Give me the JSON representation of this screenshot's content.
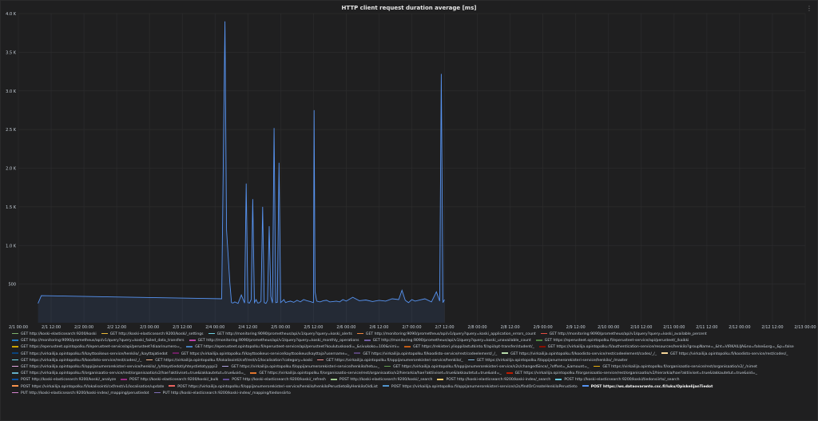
{
  "chart_data": {
    "type": "line",
    "title": "HTTP client request duration average [ms]",
    "ylim": [
      0,
      4000
    ],
    "y_ticks": [
      "4.0 K",
      "3.5 K",
      "3.0 K",
      "2.5 K",
      "2.0 K",
      "1.5 K",
      "1.0 K",
      "500"
    ],
    "y_tick_values": [
      4000,
      3500,
      3000,
      2500,
      2000,
      1500,
      1000,
      500
    ],
    "x_ticks": [
      "2/1 00:00",
      "2/1 12:00",
      "2/2 00:00",
      "2/2 12:00",
      "2/3 00:00",
      "2/3 12:00",
      "2/4 00:00",
      "2/4 12:00",
      "2/5 00:00",
      "2/5 12:00",
      "2/6 00:00",
      "2/6 12:00",
      "2/7 00:00",
      "2/7 12:00",
      "2/8 00:00",
      "2/8 12:00",
      "2/9 00:00",
      "2/9 12:00",
      "2/10 00:00",
      "2/10 12:00",
      "2/11 00:00",
      "2/11 12:00",
      "2/12 00:00",
      "2/12 12:00",
      "2/13 00:00"
    ],
    "grid": true,
    "series": [
      {
        "name": "POST https://ws.dataovaranto.csc.fi/luku/OpiskelijanTiedot",
        "color": "#5794f2",
        "x": [
          0.6,
          0.7,
          6.2,
          6.3,
          6.35,
          6.45,
          6.5,
          6.55,
          6.6,
          6.7,
          6.8,
          6.9,
          6.95,
          7.0,
          7.05,
          7.1,
          7.15,
          7.2,
          7.25,
          7.3,
          7.35,
          7.4,
          7.45,
          7.5,
          7.55,
          7.6,
          7.65,
          7.7,
          7.75,
          7.8,
          7.85,
          7.9,
          7.95,
          8.0,
          8.05,
          8.1,
          8.15,
          8.2,
          8.3,
          8.4,
          8.5,
          8.6,
          8.7,
          8.8,
          8.9,
          9.0,
          9.02,
          9.05,
          9.1,
          9.2,
          9.3,
          9.4,
          9.5,
          9.6,
          9.7,
          9.8,
          9.9,
          10.0,
          10.2,
          10.4,
          10.6,
          10.8,
          11.0,
          11.2,
          11.4,
          11.6,
          11.7,
          11.8,
          11.9,
          12.0,
          12.1,
          12.2,
          12.4,
          12.6,
          12.75,
          12.85,
          12.9,
          12.95,
          13.0
        ],
        "values": [
          250,
          350,
          310,
          3900,
          1200,
          520,
          260,
          255,
          270,
          250,
          360,
          255,
          1800,
          260,
          255,
          300,
          1600,
          262,
          300,
          255,
          258,
          280,
          1500,
          260,
          250,
          290,
          1250,
          340,
          255,
          2520,
          260,
          265,
          2070,
          260,
          280,
          300,
          260,
          270,
          280,
          265,
          290,
          270,
          300,
          285,
          275,
          260,
          2750,
          400,
          280,
          270,
          285,
          290,
          270,
          275,
          280,
          270,
          300,
          280,
          330,
          285,
          295,
          275,
          290,
          280,
          310,
          300,
          420,
          290,
          260,
          300,
          280,
          290,
          310,
          270,
          400,
          280,
          3220,
          260,
          300
        ]
      }
    ],
    "legend": [
      {
        "label": "GET http://koski-elasticsearch:9200/koski",
        "color": "#7eb26d"
      },
      {
        "label": "GET http://koski-elasticsearch:9200/koski/_settings",
        "color": "#eab839"
      },
      {
        "label": "GET http://monitoring:9090/prometheus/api/v1/query?query=koski_alerts",
        "color": "#6ed0e0"
      },
      {
        "label": "GET http://monitoring:9090/prometheus/api/v1/query?query=koski_application_errors_count",
        "color": "#ef843c"
      },
      {
        "label": "GET http://monitoring:9090/prometheus/api/v1/query?query=koski_available_percent",
        "color": "#e24d42"
      },
      {
        "label": "GET http://monitoring:9090/prometheus/api/v1/query?query=koski_failed_data_transfers",
        "color": "#1f78c1"
      },
      {
        "label": "GET http://monitoring:9090/prometheus/api/v1/query?query=koski_monthly_operations",
        "color": "#ba43a9"
      },
      {
        "label": "GET http://monitoring:9090/prometheus/api/v1/query?query=koski_unavailable_count",
        "color": "#705da0"
      },
      {
        "label": "GET https://eperusteet.opintopolku.fi/eperusteet-service/api/perusteet/_/kaikki",
        "color": "#508642"
      },
      {
        "label": "GET https://eperusteet.opintopolku.fi/eperusteet-service/api/perusteet?diaarinumero=_",
        "color": "#cca300"
      },
      {
        "label": "GET https://eperusteet.opintopolku.fi/eperusteet-service/api/perusteet?koulutuskoodi=_&sivukoko=100&nimi=",
        "color": "#447ebc"
      },
      {
        "label": "GET https://rekisteri.ylioppilastutkinto.fi/api/opt-transfer/student/_",
        "color": "#c15c17"
      },
      {
        "label": "GET https://virkailija.opintopolku.fi/authentication-service/resources/henkilo?groupName=_&ht=VIRKAILIJA&no=false&org=_&p=false",
        "color": "#890f02"
      },
      {
        "label": "GET https://virkailija.opintopolku.fi/kayttooikeus-service/henkilo/_/kayttajatiedot",
        "color": "#0a437c"
      },
      {
        "label": "GET https://virkailija.opintopolku.fi/kayttooikeus-service/kayttooikeus/kayttaja?username=_",
        "color": "#6d1f62"
      },
      {
        "label": "GET https://virkailija.opintopolku.fi/koodisto-service/rest/codeelement/_/_",
        "color": "#584477"
      },
      {
        "label": "GET https://virkailija.opintopolku.fi/koodisto-service/rest/codeelement/codes/_/_",
        "color": "#b7dbab"
      },
      {
        "label": "GET https://virkailija.opintopolku.fi/koodisto-service/rest/codes/_",
        "color": "#f4d598"
      },
      {
        "label": "GET https://virkailija.opintopolku.fi/koodisto-service/rest/codes/_/_",
        "color": "#70dbed"
      },
      {
        "label": "GET https://virkailija.opintopolku.fi/lokalisointi/cxf/rest/v1/localisation?category=koski",
        "color": "#f9ba8f"
      },
      {
        "label": "GET https://virkailija.opintopolku.fi/oppijanumerorekisteri-service/henkilo/_",
        "color": "#f29191"
      },
      {
        "label": "GET https://virkailija.opintopolku.fi/oppijanumerorekisteri-service/henkilo/_/master",
        "color": "#82b5d8"
      },
      {
        "label": "GET https://virkailija.opintopolku.fi/oppijanumerorekisteri-service/henkilo/_/yhteystiedot/yhteystietotyyppi2",
        "color": "#e5a8e2"
      },
      {
        "label": "GET https://virkailija.opintopolku.fi/oppijanumerorekisteri-service/henkilo/hetu=_",
        "color": "#aea2e0"
      },
      {
        "label": "GET https://virkailija.opintopolku.fi/oppijanumerorekisteri-service/s2s/changedSince/_?offset=_&amount=_",
        "color": "#629e51"
      },
      {
        "label": "GET https://virkailija.opintopolku.fi/organisaatio-service/rest/organisaatio/v2/_/nimet",
        "color": "#e5ac0e"
      },
      {
        "label": "GET https://virkailija.opintopolku.fi/organisaatio-service/rest/organisaatio/v2/hae?aktiiviset=true&lakkautetut=true&oid=_",
        "color": "#64b0c8"
      },
      {
        "label": "GET https://virkailija.opintopolku.fi/organisaatio-service/rest/organisaatio/v2/hierarkia/hae?aktiiviset=true&lakkautetut=true&oid=_",
        "color": "#e0752d"
      },
      {
        "label": "GET https://virkailija.opintopolku.fi/organisaatio-service/rest/organisaatio/v2/hierarkia/hae?aktiiviset=true&lakkautetut=true&oid=_",
        "color": "#bf1b00"
      },
      {
        "label": "POST http://koski-elasticsearch:9200/koski/_analyze",
        "color": "#0a50a1"
      },
      {
        "label": "POST http://koski-elasticsearch:9200/koski/_bulk",
        "color": "#962d82"
      },
      {
        "label": "POST http://koski-elasticsearch:9200/koski/_refresh",
        "color": "#614d93"
      },
      {
        "label": "POST http://koski-elasticsearch:9200/koski/_search",
        "color": "#9ac48a"
      },
      {
        "label": "POST http://koski-elasticsearch:9200/koski-index/_search",
        "color": "#f2c96d"
      },
      {
        "label": "POST http://koski-elasticsearch:9200/koski/tiedonsiirto/_search",
        "color": "#65c5db"
      },
      {
        "label": "POST https://virkailija.opintopolku.fi/lokalisointi/cxf/rest/v1/localisation/update",
        "color": "#f9934e"
      },
      {
        "label": "POST https://virkailija.opintopolku.fi/oppijanumerorekisteri-service/henkilo/henkiloPerustietoByHenkiloOidList",
        "color": "#ea6460"
      },
      {
        "label": "POST https://virkailija.opintopolku.fi/oppijanumerorekisteri-service/s2s/findOrCreateHenkiloPerustieto",
        "color": "#5195ce"
      },
      {
        "label": "POST https://ws.dataovaranto.csc.fi/luku/OpiskelijanTiedot",
        "color": "#5794f2",
        "highlight": true
      },
      {
        "label": "PUT http://koski-elasticsearch:9200/koski-index/_mapping/perustiedot",
        "color": "#d683ce"
      },
      {
        "label": "PUT http://koski-elasticsearch:9200/koski-index/_mapping/tiedonsiirto",
        "color": "#806eb7"
      }
    ]
  }
}
